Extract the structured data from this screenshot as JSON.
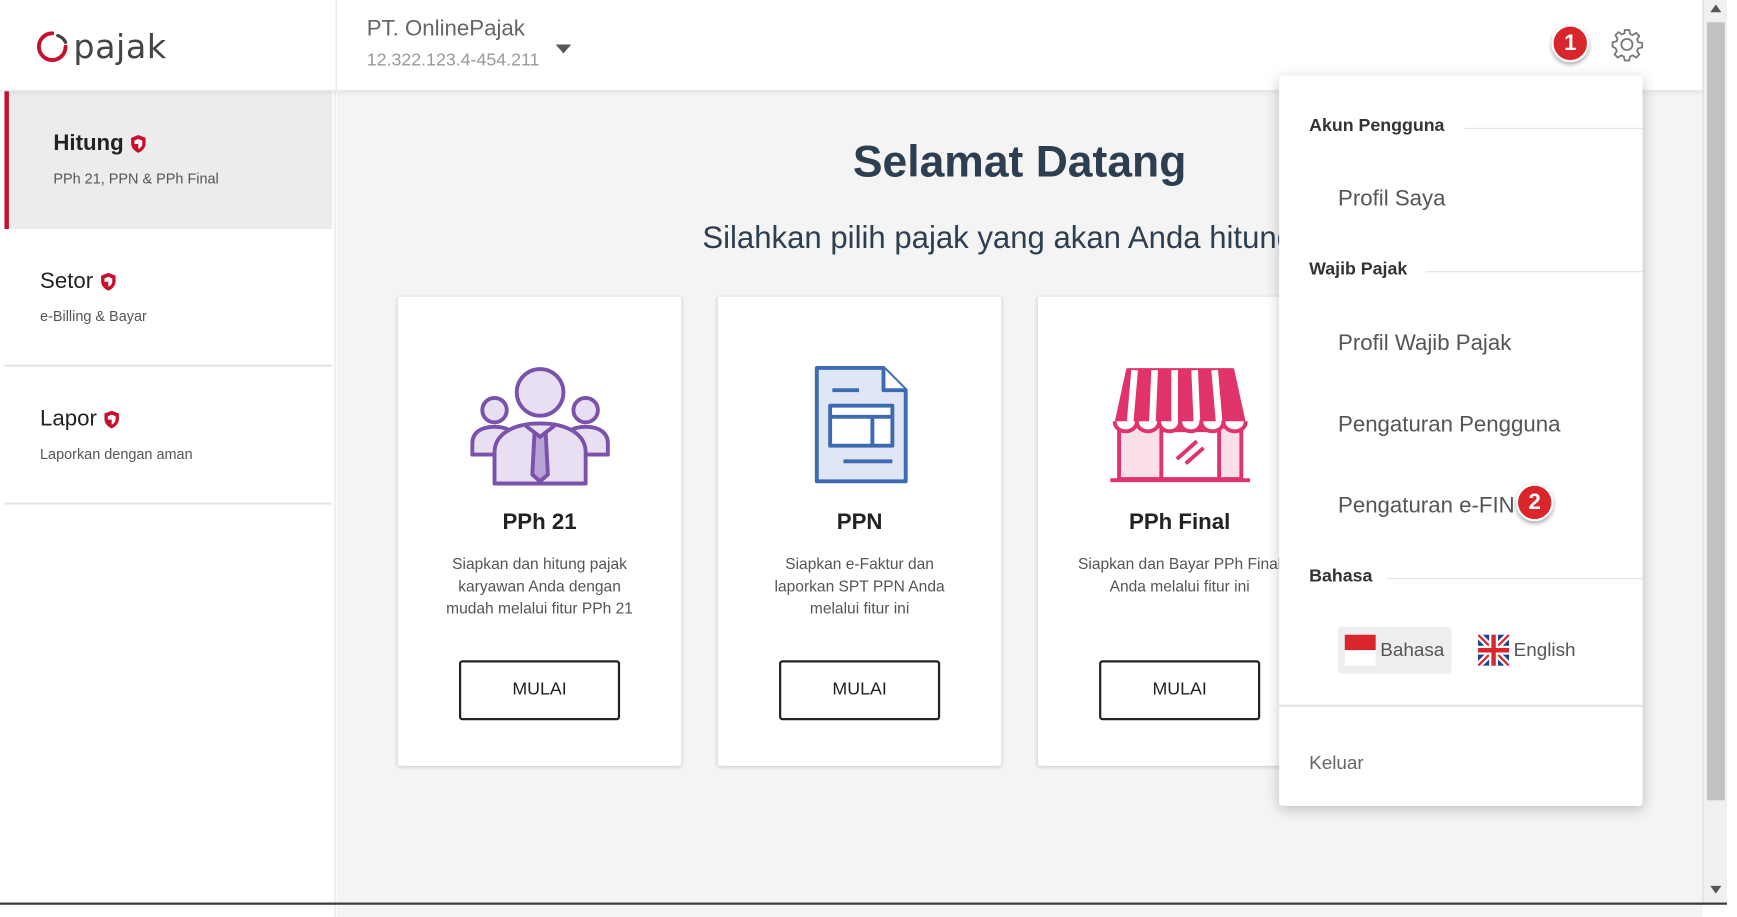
{
  "header": {
    "logo_text": "pajak",
    "company_name": "PT. OnlinePajak",
    "company_npwp": "12.322.123.4-454.211",
    "badge_1": "1"
  },
  "sidebar": {
    "items": [
      {
        "title": "Hitung",
        "subtitle": "PPh 21, PPN & PPh Final"
      },
      {
        "title": "Setor",
        "subtitle": "e-Billing & Bayar"
      },
      {
        "title": "Lapor",
        "subtitle": "Laporkan dengan aman"
      }
    ]
  },
  "main": {
    "welcome": "Selamat Datang",
    "subtitle": "Silahkan pilih pajak yang akan Anda hitung",
    "cards": [
      {
        "title": "PPh 21",
        "desc": "Siapkan dan hitung pajak karyawan Anda dengan mudah melalui fitur PPh 21",
        "button": "MULAI",
        "icon": "people-icon",
        "color": "#7b52ab"
      },
      {
        "title": "PPN",
        "desc": "Siapkan e-Faktur dan laporkan SPT PPN Anda melalui fitur ini",
        "button": "MULAI",
        "icon": "document-icon",
        "color": "#3d6bb3"
      },
      {
        "title": "PPh Final",
        "desc": "Siapkan dan Bayar PPh Final Anda melalui fitur ini",
        "button": "MULAI",
        "icon": "store-icon",
        "color": "#e0336a"
      }
    ]
  },
  "dropdown": {
    "section_account": "Akun Pengguna",
    "profile": "Profil Saya",
    "section_taxpayer": "Wajib Pajak",
    "taxpayer_profile": "Profil Wajib Pajak",
    "user_settings": "Pengaturan Pengguna",
    "efin_settings": "Pengaturan e-FIN",
    "badge_2": "2",
    "section_language": "Bahasa",
    "lang_id": "Bahasa",
    "lang_en": "English",
    "logout": "Keluar"
  },
  "colors": {
    "accent_red": "#c8102e",
    "badge_red": "#d9262c",
    "heading": "#2d3e50"
  }
}
